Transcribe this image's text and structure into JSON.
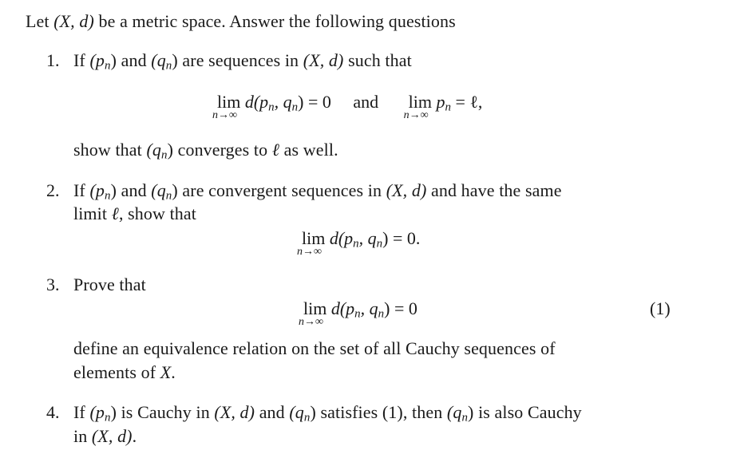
{
  "intro": {
    "text_a": "Let ",
    "space": "(X, d)",
    "text_b": " be a metric space. Answer the following questions"
  },
  "questions": [
    {
      "number": "1.",
      "line1_a": "If ",
      "p": "(p",
      "sub": "n",
      "close": ")",
      "and": " and ",
      "q": "(q",
      "line1_b": " are sequences in ",
      "space": "(X, d)",
      "line1_c": " such that",
      "display": {
        "lim": "lim",
        "under": "n→∞",
        "expr1": "d(p",
        "expr1_sub": "n",
        "expr1_mid": ", q",
        "expr1_end": ") = 0",
        "connector": "and",
        "expr2": "p",
        "expr2_sub": "n",
        "expr2_end": " = ℓ,"
      },
      "line2_a": "show that ",
      "line2_q": "(q",
      "line2_b": " converges to ",
      "ell": "ℓ",
      "line2_c": " as well."
    },
    {
      "number": "2.",
      "line1_a": "If ",
      "and": " and ",
      "line1_b": " are convergent sequences in ",
      "space": "(X, d)",
      "line1_c": " and have the same",
      "line2_a": "limit ",
      "ell": "ℓ",
      "line2_b": ", show that",
      "display": {
        "lim": "lim",
        "under": "n→∞",
        "expr": "d(p",
        "sub": "n",
        "mid": ", q",
        "end": ") = 0."
      }
    },
    {
      "number": "3.",
      "line1": "Prove that",
      "display": {
        "lim": "lim",
        "under": "n→∞",
        "expr": "d(p",
        "sub": "n",
        "mid": ", q",
        "end": ") = 0",
        "eq_label": "(1)"
      },
      "line2": "define an equivalence relation on the set of all Cauchy sequences of",
      "line3_a": "elements of ",
      "line3_x": "X",
      "line3_b": "."
    },
    {
      "number": "4.",
      "line1_a": "If ",
      "line1_b": " is Cauchy in ",
      "space": "(X, d)",
      "line1_c": " and ",
      "line1_d": " satisfies (1), then ",
      "line1_e": " is also Cauchy",
      "line2_a": "in ",
      "line2_space": "(X, d)",
      "line2_b": "."
    }
  ]
}
